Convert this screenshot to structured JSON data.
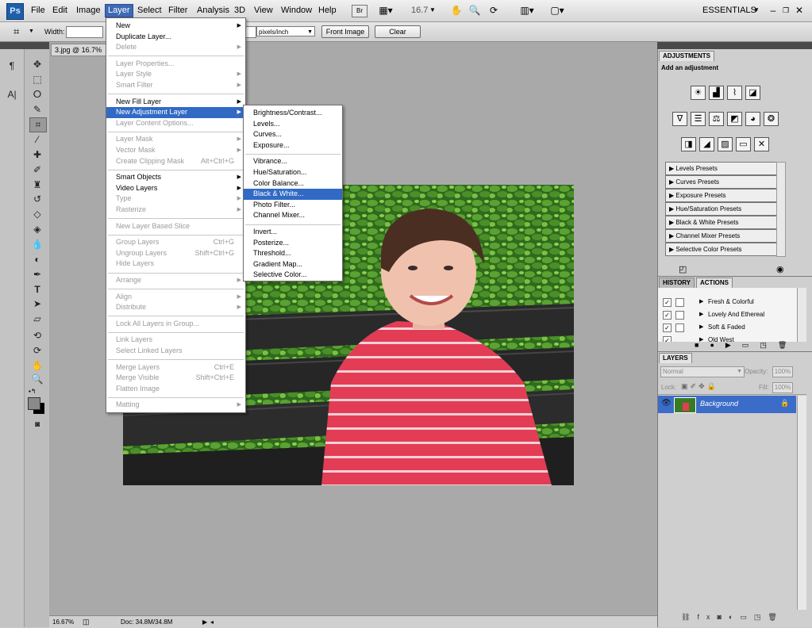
{
  "app": {
    "logo": "Ps",
    "workspace": "ESSENTIALS",
    "zoom_display": "16.7"
  },
  "menubar": [
    "File",
    "Edit",
    "Image",
    "Layer",
    "Select",
    "Filter",
    "Analysis",
    "3D",
    "View",
    "Window",
    "Help"
  ],
  "options_bar": {
    "width_label": "Width:",
    "resolution_unit": "pixels/inch",
    "front_image_button": "Front Image",
    "clear_button": "Clear"
  },
  "document": {
    "tab_title": "3.jpg @ 16.7%"
  },
  "status_bar": {
    "zoom": "16.67%",
    "doc_info": "Doc: 34.8M/34.8M"
  },
  "layer_menu": {
    "items": [
      {
        "label": "New",
        "submenu": true
      },
      {
        "label": "Duplicate Layer..."
      },
      {
        "label": "Delete",
        "disabled": true,
        "submenu": true
      },
      {
        "sep": true
      },
      {
        "label": "Layer Properties...",
        "disabled": true
      },
      {
        "label": "Layer Style",
        "disabled": true,
        "submenu": true
      },
      {
        "label": "Smart Filter",
        "disabled": true,
        "submenu": true
      },
      {
        "sep": true
      },
      {
        "label": "New Fill Layer",
        "submenu": true
      },
      {
        "label": "New Adjustment Layer",
        "submenu": true,
        "highlight": true
      },
      {
        "label": "Layer Content Options...",
        "disabled": true
      },
      {
        "sep": true
      },
      {
        "label": "Layer Mask",
        "disabled": true,
        "submenu": true
      },
      {
        "label": "Vector Mask",
        "disabled": true,
        "submenu": true
      },
      {
        "label": "Create Clipping Mask",
        "disabled": true,
        "shortcut": "Alt+Ctrl+G"
      },
      {
        "sep": true
      },
      {
        "label": "Smart Objects",
        "submenu": true
      },
      {
        "label": "Video Layers",
        "submenu": true
      },
      {
        "label": "Type",
        "disabled": true,
        "submenu": true
      },
      {
        "label": "Rasterize",
        "disabled": true,
        "submenu": true
      },
      {
        "sep": true
      },
      {
        "label": "New Layer Based Slice",
        "disabled": true
      },
      {
        "sep": true
      },
      {
        "label": "Group Layers",
        "disabled": true,
        "shortcut": "Ctrl+G"
      },
      {
        "label": "Ungroup Layers",
        "disabled": true,
        "shortcut": "Shift+Ctrl+G"
      },
      {
        "label": "Hide Layers",
        "disabled": true
      },
      {
        "sep": true
      },
      {
        "label": "Arrange",
        "disabled": true,
        "submenu": true
      },
      {
        "sep": true
      },
      {
        "label": "Align",
        "disabled": true,
        "submenu": true
      },
      {
        "label": "Distribute",
        "disabled": true,
        "submenu": true
      },
      {
        "sep": true
      },
      {
        "label": "Lock All Layers in Group...",
        "disabled": true
      },
      {
        "sep": true
      },
      {
        "label": "Link Layers",
        "disabled": true
      },
      {
        "label": "Select Linked Layers",
        "disabled": true
      },
      {
        "sep": true
      },
      {
        "label": "Merge Layers",
        "disabled": true,
        "shortcut": "Ctrl+E"
      },
      {
        "label": "Merge Visible",
        "disabled": true,
        "shortcut": "Shift+Ctrl+E"
      },
      {
        "label": "Flatten Image",
        "disabled": true
      },
      {
        "sep": true
      },
      {
        "label": "Matting",
        "disabled": true,
        "submenu": true
      }
    ]
  },
  "adjustment_submenu": {
    "items": [
      {
        "label": "Brightness/Contrast..."
      },
      {
        "label": "Levels..."
      },
      {
        "label": "Curves..."
      },
      {
        "label": "Exposure..."
      },
      {
        "sep": true
      },
      {
        "label": "Vibrance..."
      },
      {
        "label": "Hue/Saturation..."
      },
      {
        "label": "Color Balance..."
      },
      {
        "label": "Black & White...",
        "highlight": true
      },
      {
        "label": "Photo Filter..."
      },
      {
        "label": "Channel Mixer..."
      },
      {
        "sep": true
      },
      {
        "label": "Invert..."
      },
      {
        "label": "Posterize..."
      },
      {
        "label": "Threshold..."
      },
      {
        "label": "Gradient Map..."
      },
      {
        "label": "Selective Color..."
      }
    ]
  },
  "adjustments_panel": {
    "tab": "ADJUSTMENTS",
    "heading": "Add an adjustment",
    "presets": [
      "Levels Presets",
      "Curves Presets",
      "Exposure Presets",
      "Hue/Saturation Presets",
      "Black & White Presets",
      "Channel Mixer Presets",
      "Selective Color Presets"
    ]
  },
  "history_actions": {
    "tabs": [
      "HISTORY",
      "ACTIONS"
    ],
    "actions": [
      "Fresh & Colorful",
      "Lovely And Ethereal",
      "Soft & Faded",
      "Old West"
    ]
  },
  "layers_panel": {
    "tab": "LAYERS",
    "blend_mode": "Normal",
    "opacity_label": "Opacity:",
    "opacity_value": "100%",
    "lock_label": "Lock:",
    "fill_label": "Fill:",
    "fill_value": "100%",
    "layer_name": "Background"
  },
  "colors": {
    "accent": "#316ac5",
    "layer_selected": "#3a6cc8"
  }
}
